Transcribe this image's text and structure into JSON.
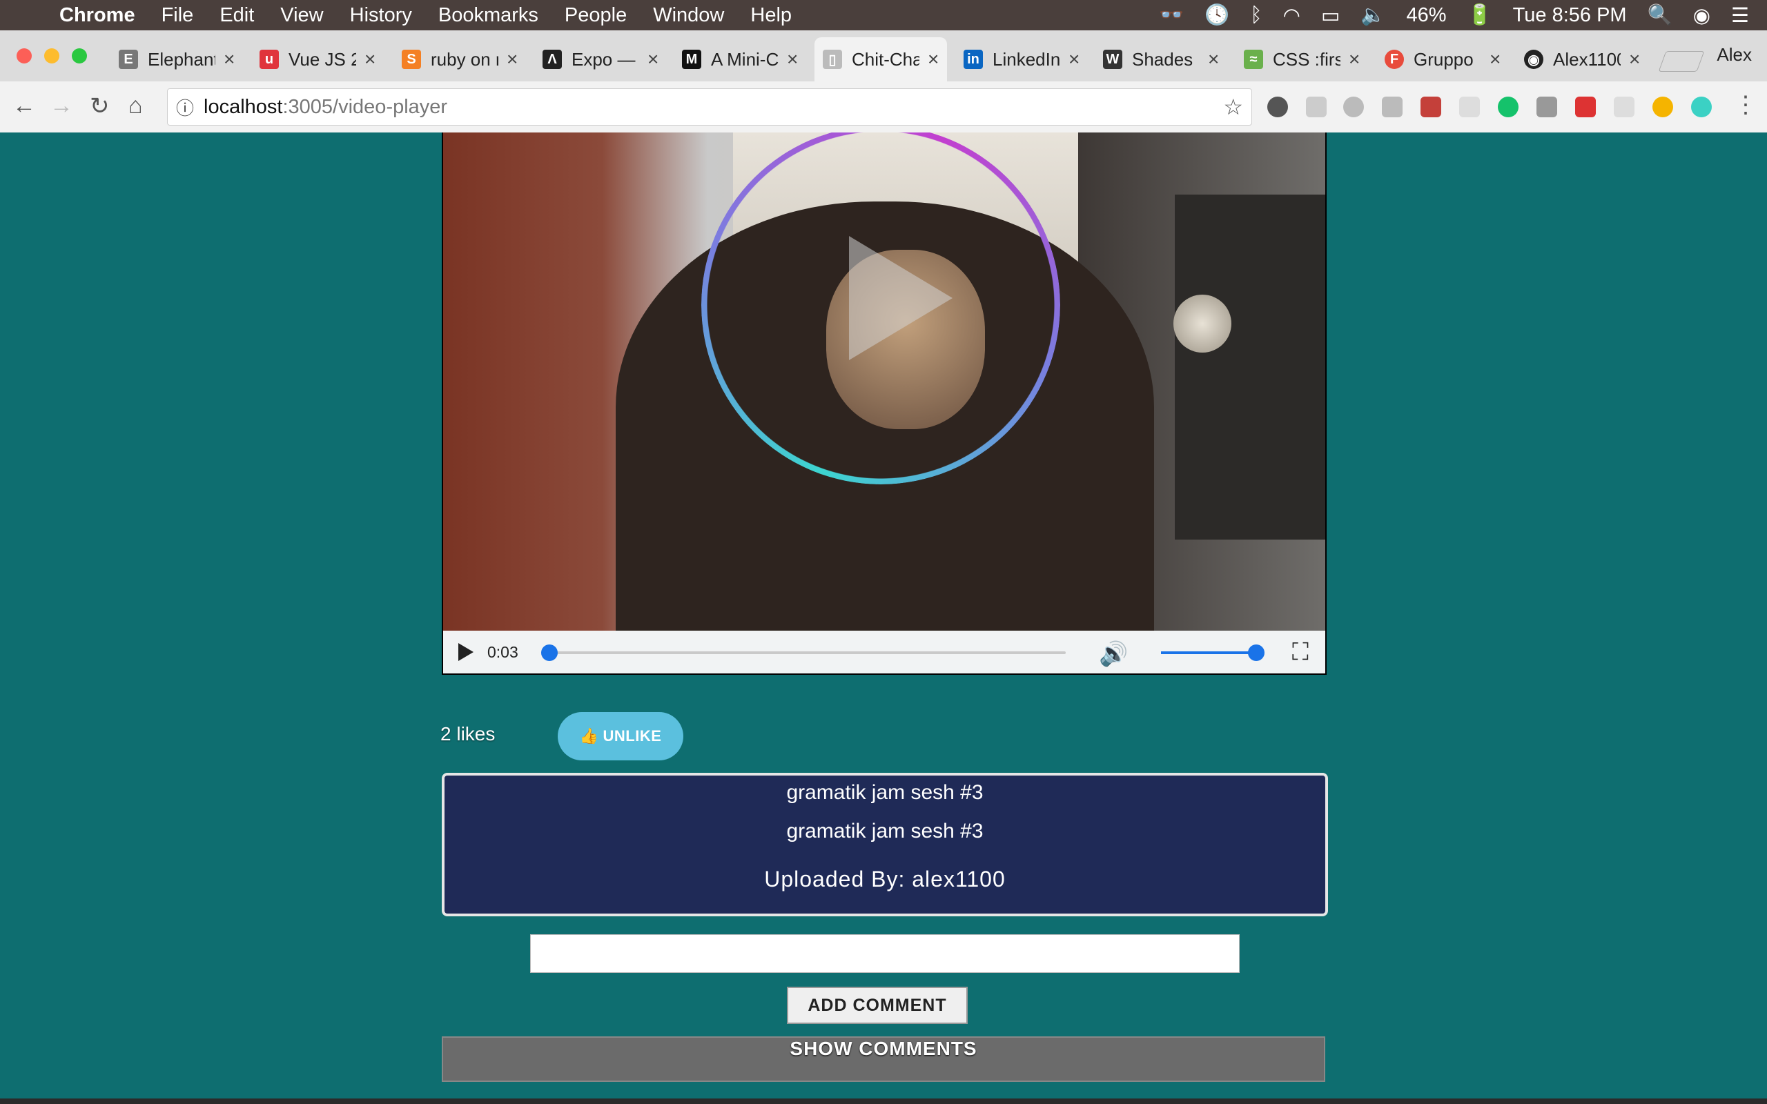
{
  "menubar": {
    "app": "Chrome",
    "items": [
      "File",
      "Edit",
      "View",
      "History",
      "Bookmarks",
      "People",
      "Window",
      "Help"
    ],
    "battery": "46%",
    "clock": "Tue 8:56 PM"
  },
  "tabs": [
    {
      "title": "Elephant",
      "favicon": "elephant-icon",
      "color": "#777"
    },
    {
      "title": "Vue JS 2",
      "favicon": "udemy-icon",
      "color": "#e0343c"
    },
    {
      "title": "ruby on r",
      "favicon": "stackoverflow-icon",
      "color": "#f48024"
    },
    {
      "title": "Expo —",
      "favicon": "expo-icon",
      "color": "#222"
    },
    {
      "title": "A Mini-C",
      "favicon": "medium-icon",
      "color": "#111"
    },
    {
      "title": "Chit-Cha",
      "favicon": "page-icon",
      "color": "#999",
      "active": true
    },
    {
      "title": "LinkedIn",
      "favicon": "linkedin-icon",
      "color": "#0a66c2"
    },
    {
      "title": "Shades",
      "favicon": "wikipedia-icon",
      "color": "#333"
    },
    {
      "title": "CSS :firs",
      "favicon": "css-icon",
      "color": "#6ab04c"
    },
    {
      "title": "Gruppo",
      "favicon": "gruppo-icon",
      "color": "#e84b3c"
    },
    {
      "title": "Alex1100",
      "favicon": "github-icon",
      "color": "#222"
    }
  ],
  "profile": "Alex",
  "address": {
    "host": "localhost",
    "path": ":3005/video-player"
  },
  "video": {
    "time": "0:03",
    "progress": 0.0,
    "volume": 1.0
  },
  "likes": "2 likes",
  "unlike_label": "Unlike",
  "info": {
    "title": "gramatik jam sesh #3",
    "description": "gramatik jam sesh #3",
    "uploaded_by": "Uploaded By: alex1100"
  },
  "comment_placeholder": "",
  "add_comment_label": "Add Comment",
  "show_comments_label": "Show Comments"
}
